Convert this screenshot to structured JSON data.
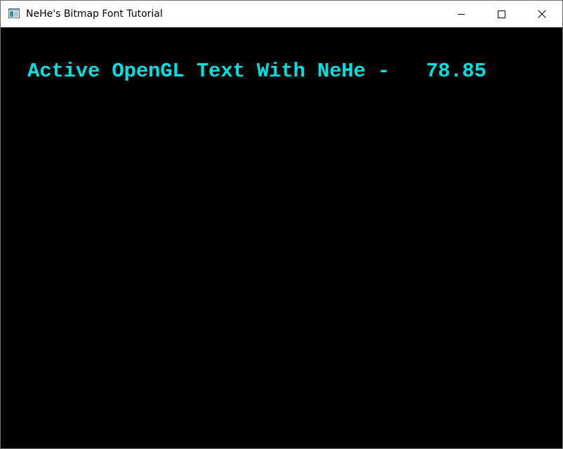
{
  "window": {
    "title": "NeHe's Bitmap Font Tutorial",
    "app_icon": "window-app-icon",
    "controls": {
      "minimize_icon": "minimize-icon",
      "maximize_icon": "maximize-icon",
      "close_icon": "close-icon"
    }
  },
  "gl_scene": {
    "background_color": "#000000",
    "text": "Active OpenGL Text With NeHe -   78.85",
    "text_color": "#00e0e0"
  }
}
